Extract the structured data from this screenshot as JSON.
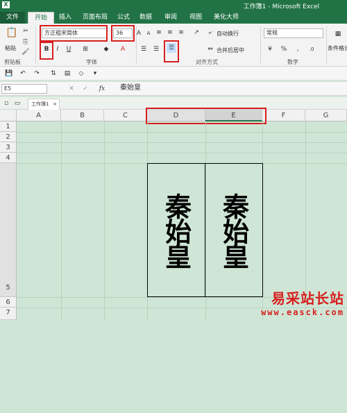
{
  "window": {
    "title": "工作簿1 - Microsoft Excel"
  },
  "tabs": [
    "文件",
    "开始",
    "插入",
    "页面布局",
    "公式",
    "数据",
    "审阅",
    "视图",
    "美化大师"
  ],
  "ribbon": {
    "paste_label": "粘贴",
    "font_name": "方正粗宋简体",
    "font_size": "36",
    "bold": "B",
    "italic": "I",
    "underline": "U",
    "wrap_text": "自动换行",
    "merge_center": "合并后居中",
    "number_format": "常规",
    "cond_format": "条件格式",
    "groups": {
      "clipboard": "剪贴板",
      "font": "字体",
      "alignment": "对齐方式",
      "number": "数字"
    }
  },
  "formula_bar": {
    "name_box": "E5",
    "fx": "fx",
    "content": "秦始皇"
  },
  "workbook_tab": "工作簿1",
  "columns": [
    "A",
    "B",
    "C",
    "D",
    "E",
    "F",
    "G"
  ],
  "rows": [
    "1",
    "2",
    "3",
    "4",
    "5",
    "6",
    "7"
  ],
  "cells": {
    "D5": "秦始皇",
    "E5": "秦始皇"
  },
  "watermark": {
    "line1": "易采站长站",
    "line2": "www.easck.com"
  },
  "colors": {
    "excel_green": "#217346",
    "highlight_red": "#d81e1e",
    "sheet_bg": "#cfe6d6"
  }
}
